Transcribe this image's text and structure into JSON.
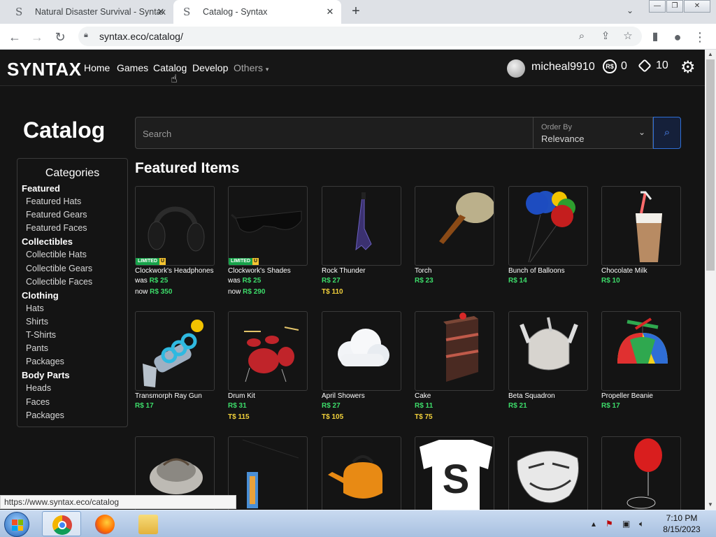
{
  "browser": {
    "tabs": [
      {
        "title": "Natural Disaster Survival - Syntax",
        "active": false
      },
      {
        "title": "Catalog - Syntax",
        "active": true
      }
    ],
    "url": "syntax.eco/catalog/",
    "status_url": "https://www.syntax.eco/catalog"
  },
  "site": {
    "logo": "SYNTAX",
    "nav": [
      "Home",
      "Games",
      "Catalog",
      "Develop",
      "Others"
    ],
    "username": "micheal9910",
    "robux": "0",
    "tix": "10"
  },
  "catalog": {
    "title": "Catalog",
    "search_placeholder": "Search",
    "order_by_label": "Order By",
    "order_by_value": "Relevance",
    "featured_title": "Featured Items"
  },
  "categories": {
    "title": "Categories",
    "items": [
      {
        "label": "Featured",
        "head": true
      },
      {
        "label": "Featured Hats",
        "head": false
      },
      {
        "label": "Featured Gears",
        "head": false
      },
      {
        "label": "Featured Faces",
        "head": false
      },
      {
        "label": "Collectibles",
        "head": true
      },
      {
        "label": "Collectible Hats",
        "head": false
      },
      {
        "label": "Collectible Gears",
        "head": false
      },
      {
        "label": "Collectible Faces",
        "head": false
      },
      {
        "label": "Clothing",
        "head": true
      },
      {
        "label": "Hats",
        "head": false
      },
      {
        "label": "Shirts",
        "head": false
      },
      {
        "label": "T-Shirts",
        "head": false
      },
      {
        "label": "Pants",
        "head": false
      },
      {
        "label": "Packages",
        "head": false
      },
      {
        "label": "Body Parts",
        "head": true
      },
      {
        "label": "Heads",
        "head": false
      },
      {
        "label": "Faces",
        "head": false
      },
      {
        "label": "Packages",
        "head": false
      }
    ]
  },
  "items": [
    {
      "name": "Clockwork's Headphones",
      "limited": true,
      "was": "R$ 25",
      "now": "R$ 350",
      "icon": "headphones"
    },
    {
      "name": "Clockwork's Shades",
      "limited": true,
      "was": "R$ 25",
      "now": "R$ 290",
      "icon": "shades"
    },
    {
      "name": "Rock Thunder",
      "robux": "R$ 27",
      "tix": "T$ 110",
      "icon": "guitar"
    },
    {
      "name": "Torch",
      "robux": "R$ 23",
      "icon": "torch"
    },
    {
      "name": "Bunch of Balloons",
      "robux": "R$ 14",
      "icon": "balloons"
    },
    {
      "name": "Chocolate Milk",
      "robux": "R$ 10",
      "icon": "cup"
    },
    {
      "name": "Transmorph Ray Gun",
      "robux": "R$ 17",
      "icon": "raygun"
    },
    {
      "name": "Drum Kit",
      "robux": "R$ 31",
      "tix": "T$ 115",
      "icon": "drums"
    },
    {
      "name": "April Showers",
      "robux": "R$ 27",
      "tix": "T$ 105",
      "icon": "cloud"
    },
    {
      "name": "Cake",
      "robux": "R$ 11",
      "tix": "T$ 75",
      "icon": "cake"
    },
    {
      "name": "Beta Squadron",
      "robux": "R$ 21",
      "icon": "helmet"
    },
    {
      "name": "Propeller Beanie",
      "robux": "R$ 17",
      "icon": "beanie"
    },
    {
      "name": "",
      "icon": "hat"
    },
    {
      "name": "",
      "icon": "tag"
    },
    {
      "name": "",
      "limited": true,
      "icon": "kettle"
    },
    {
      "name": "",
      "icon": "shirt"
    },
    {
      "name": "",
      "icon": "trollface"
    },
    {
      "name": "",
      "icon": "red-balloon"
    }
  ],
  "labels": {
    "limited": "LIMITED",
    "unique": "U",
    "was": "was",
    "now": "now"
  },
  "taskbar": {
    "time": "7:10 PM",
    "date": "8/15/2023"
  }
}
